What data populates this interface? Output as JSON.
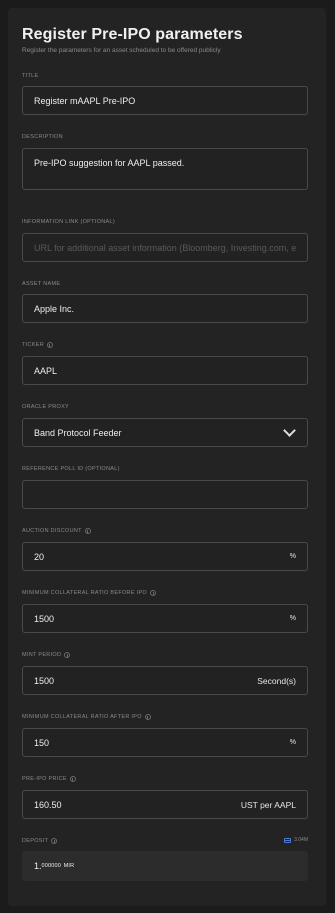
{
  "header": {
    "title": "Register Pre-IPO parameters",
    "subtitle": "Register the parameters for an asset scheduled to be offered publicly"
  },
  "fields": {
    "title": {
      "label": "TITLE",
      "value": "Register mAAPL Pre-IPO"
    },
    "description": {
      "label": "DESCRIPTION",
      "value": "Pre-IPO suggestion for AAPL passed."
    },
    "info_link": {
      "label": "INFORMATION LINK (OPTIONAL)",
      "placeholder": "URL for additional asset information (Bloomberg, Investing.com, etc.)"
    },
    "asset_name": {
      "label": "ASSET NAME",
      "value": "Apple Inc."
    },
    "ticker": {
      "label": "TICKER",
      "value": "AAPL"
    },
    "oracle_proxy": {
      "label": "ORACLE PROXY",
      "value": "Band Protocol Feeder"
    },
    "reference_poll": {
      "label": "REFERENCE POLL ID (OPTIONAL)",
      "value": ""
    },
    "auction_discount": {
      "label": "AUCTION DISCOUNT",
      "value": "20",
      "unit": "%"
    },
    "min_collateral_before": {
      "label": "MINIMUM COLLATERAL RATIO BEFORE IPO",
      "value": "1500",
      "unit": "%"
    },
    "mint_period": {
      "label": "MINT PERIOD",
      "value": "1500",
      "unit": "Second(s)"
    },
    "min_collateral_after": {
      "label": "MINIMUM COLLATERAL RATIO AFTER IPO",
      "value": "150",
      "unit": "%"
    },
    "pre_ipo_price": {
      "label": "PRE-IPO PRICE",
      "value": "160.50",
      "unit": "UST per AAPL"
    },
    "deposit": {
      "label": "DEPOSIT",
      "balance": "3.04M",
      "amount_int": "1.",
      "amount_dec": "000000",
      "amount_unit": "MIR"
    }
  },
  "icons": {
    "info": "info-circle-icon",
    "chevron": "chevron-down-icon",
    "wallet": "wallet-icon"
  },
  "colors": {
    "background": "#1b1b1b",
    "card": "#232323",
    "border": "#4a4a4a",
    "accent": "#4a7ad8"
  }
}
